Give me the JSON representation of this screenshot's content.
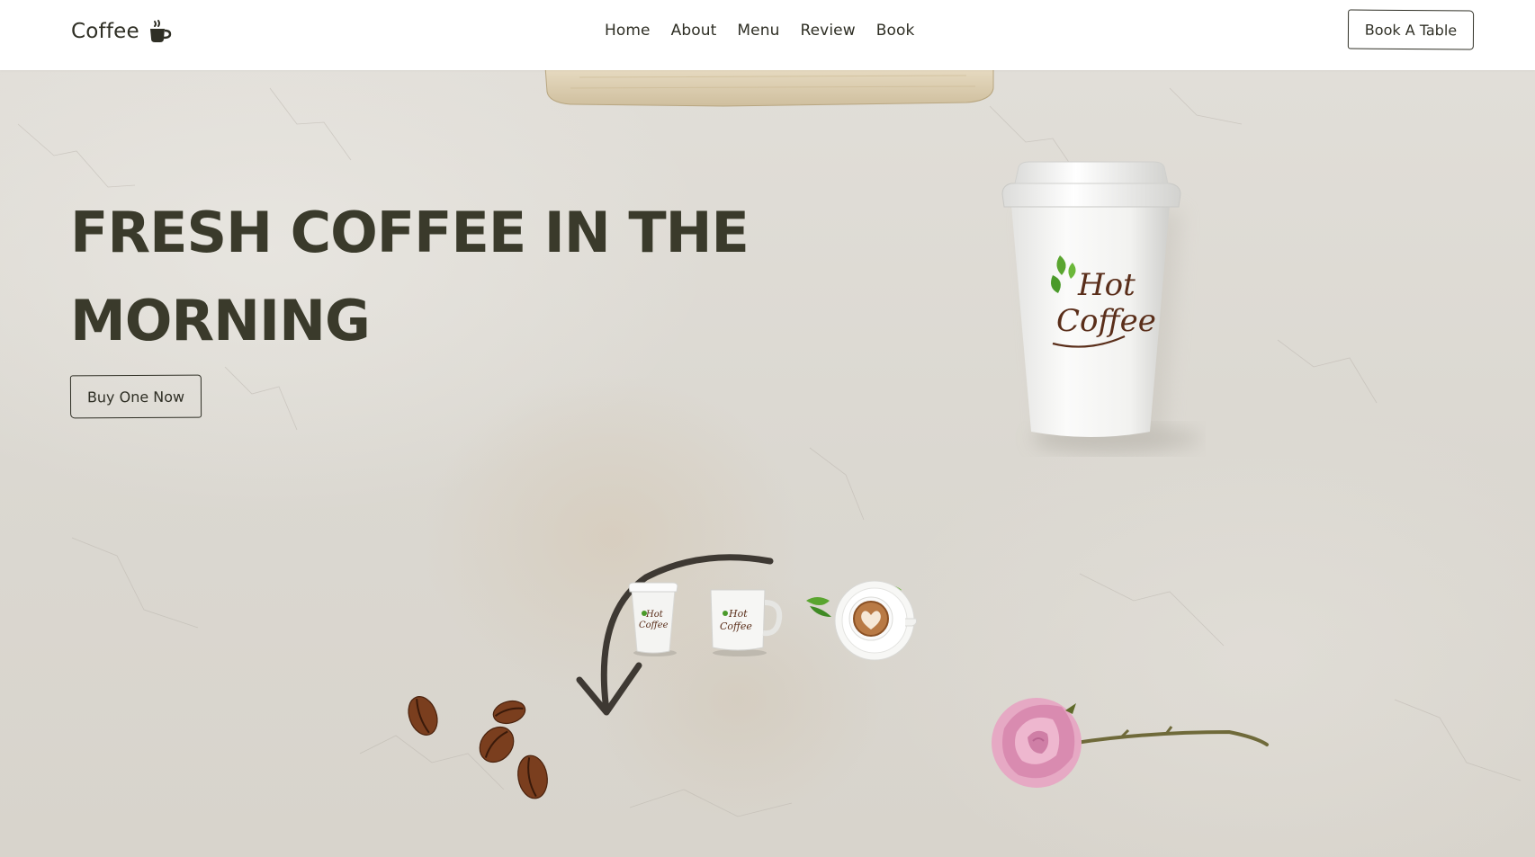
{
  "brand": {
    "name": "Coffee",
    "icon": "coffee-cup-icon"
  },
  "nav": {
    "items": [
      {
        "label": "Home"
      },
      {
        "label": "About"
      },
      {
        "label": "Menu"
      },
      {
        "label": "Review"
      },
      {
        "label": "Book"
      }
    ],
    "cta_label": "Book A Table"
  },
  "hero": {
    "headline": "FRESH COFFEE IN THE MORNING",
    "button_label": "Buy One Now"
  },
  "product_thumbnails": [
    {
      "name": "paper-cup"
    },
    {
      "name": "mug"
    },
    {
      "name": "latte-cup"
    }
  ],
  "colors": {
    "text": "#3a3a2b",
    "nav_bg": "#ffffff",
    "concrete": "#dedad2",
    "coffee_brown": "#5a2e1a",
    "leaf_green": "#4a9a2a",
    "rose_pink": "#e6a9c4"
  }
}
